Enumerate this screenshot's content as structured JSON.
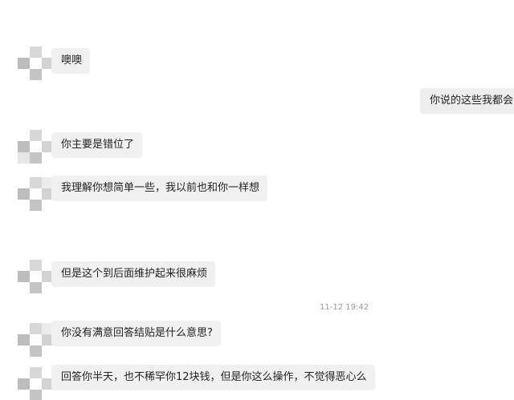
{
  "messages": [
    {
      "side": "left",
      "text": "噢噢"
    },
    {
      "side": "right",
      "text": "你说的这些我都会"
    },
    {
      "side": "left",
      "text": "你主要是错位了"
    },
    {
      "side": "left",
      "text": "我理解你想简单一些，我以前也和你一样想"
    },
    {
      "side": "left",
      "text": "但是这个到后面维护起来很麻烦"
    },
    {
      "side": "left",
      "text": "你没有满意回答结贴是什么意思?"
    },
    {
      "side": "left",
      "text": "回答你半天，也不稀罕你12块钱，但是你这么操作，不觉得恶心么"
    }
  ],
  "timestamp": "11-12 19:42",
  "colors": {
    "bubble": "#f0f0f0",
    "background": "#ffffff",
    "timestamp": "#9a9a9a"
  }
}
